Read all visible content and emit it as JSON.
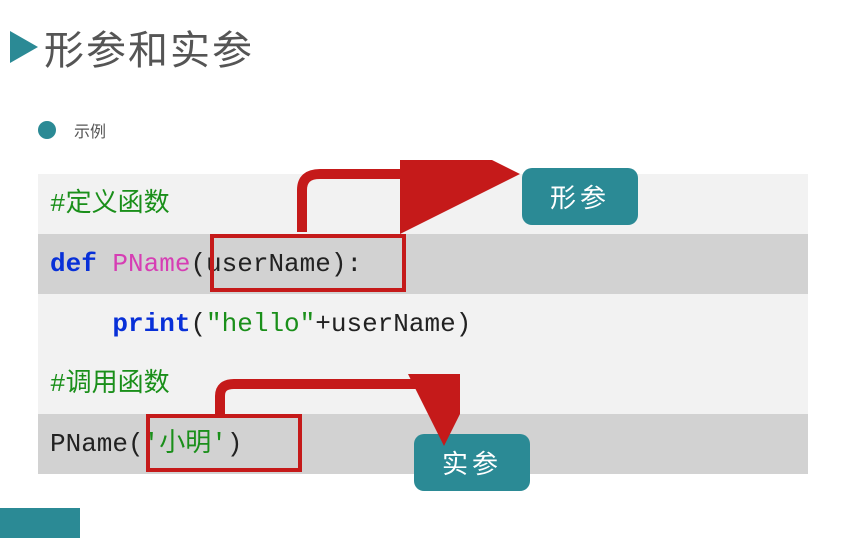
{
  "title": "形参和实参",
  "subbullet": "示例",
  "code": {
    "comment_def": "#定义函数",
    "kw_def": "def",
    "func_name": "PName",
    "param_open": "(",
    "param_name": "userName",
    "param_close": ")",
    "colon": ":",
    "print_kw": "print",
    "print_open": "(",
    "str_hello": "\"hello\"",
    "plus": "+",
    "print_arg": "userName",
    "print_close": ")",
    "comment_call": "#调用函数",
    "call_name": "PName",
    "call_open": "(",
    "call_arg": "'小明'",
    "call_close": ")"
  },
  "labels": {
    "formal_param": "形参",
    "actual_param": "实参"
  }
}
